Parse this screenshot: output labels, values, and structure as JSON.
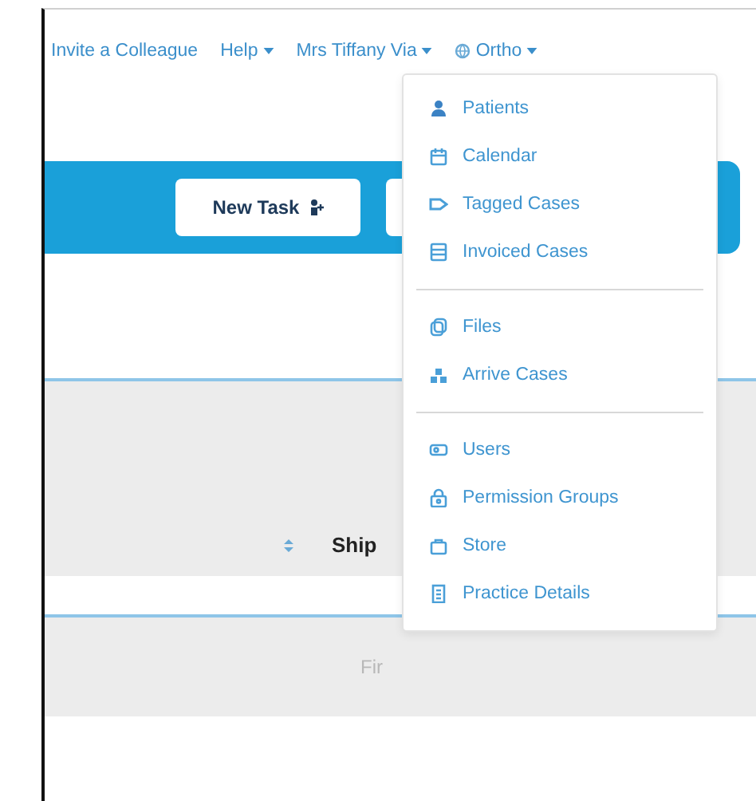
{
  "top_nav": [
    {
      "label": "Invite a Colleague",
      "caret": false
    },
    {
      "label": "Help",
      "caret": true
    },
    {
      "label": "Mrs Tiffany Via",
      "caret": true
    },
    {
      "label": "Ortho",
      "caret": true,
      "globe": true
    }
  ],
  "toolbar": {
    "buttons": [
      "New Task"
    ]
  },
  "table": {
    "sort_column": "Ship",
    "filter_placeholder": "Fir"
  },
  "dropdown": {
    "sections": [
      [
        "Patients",
        "Calendar",
        "Tagged Cases",
        "Invoiced Cases"
      ],
      [
        "Files",
        "Arrive Cases"
      ],
      [
        "Users",
        "Permission Groups",
        "Store",
        "Practice Details"
      ]
    ]
  }
}
